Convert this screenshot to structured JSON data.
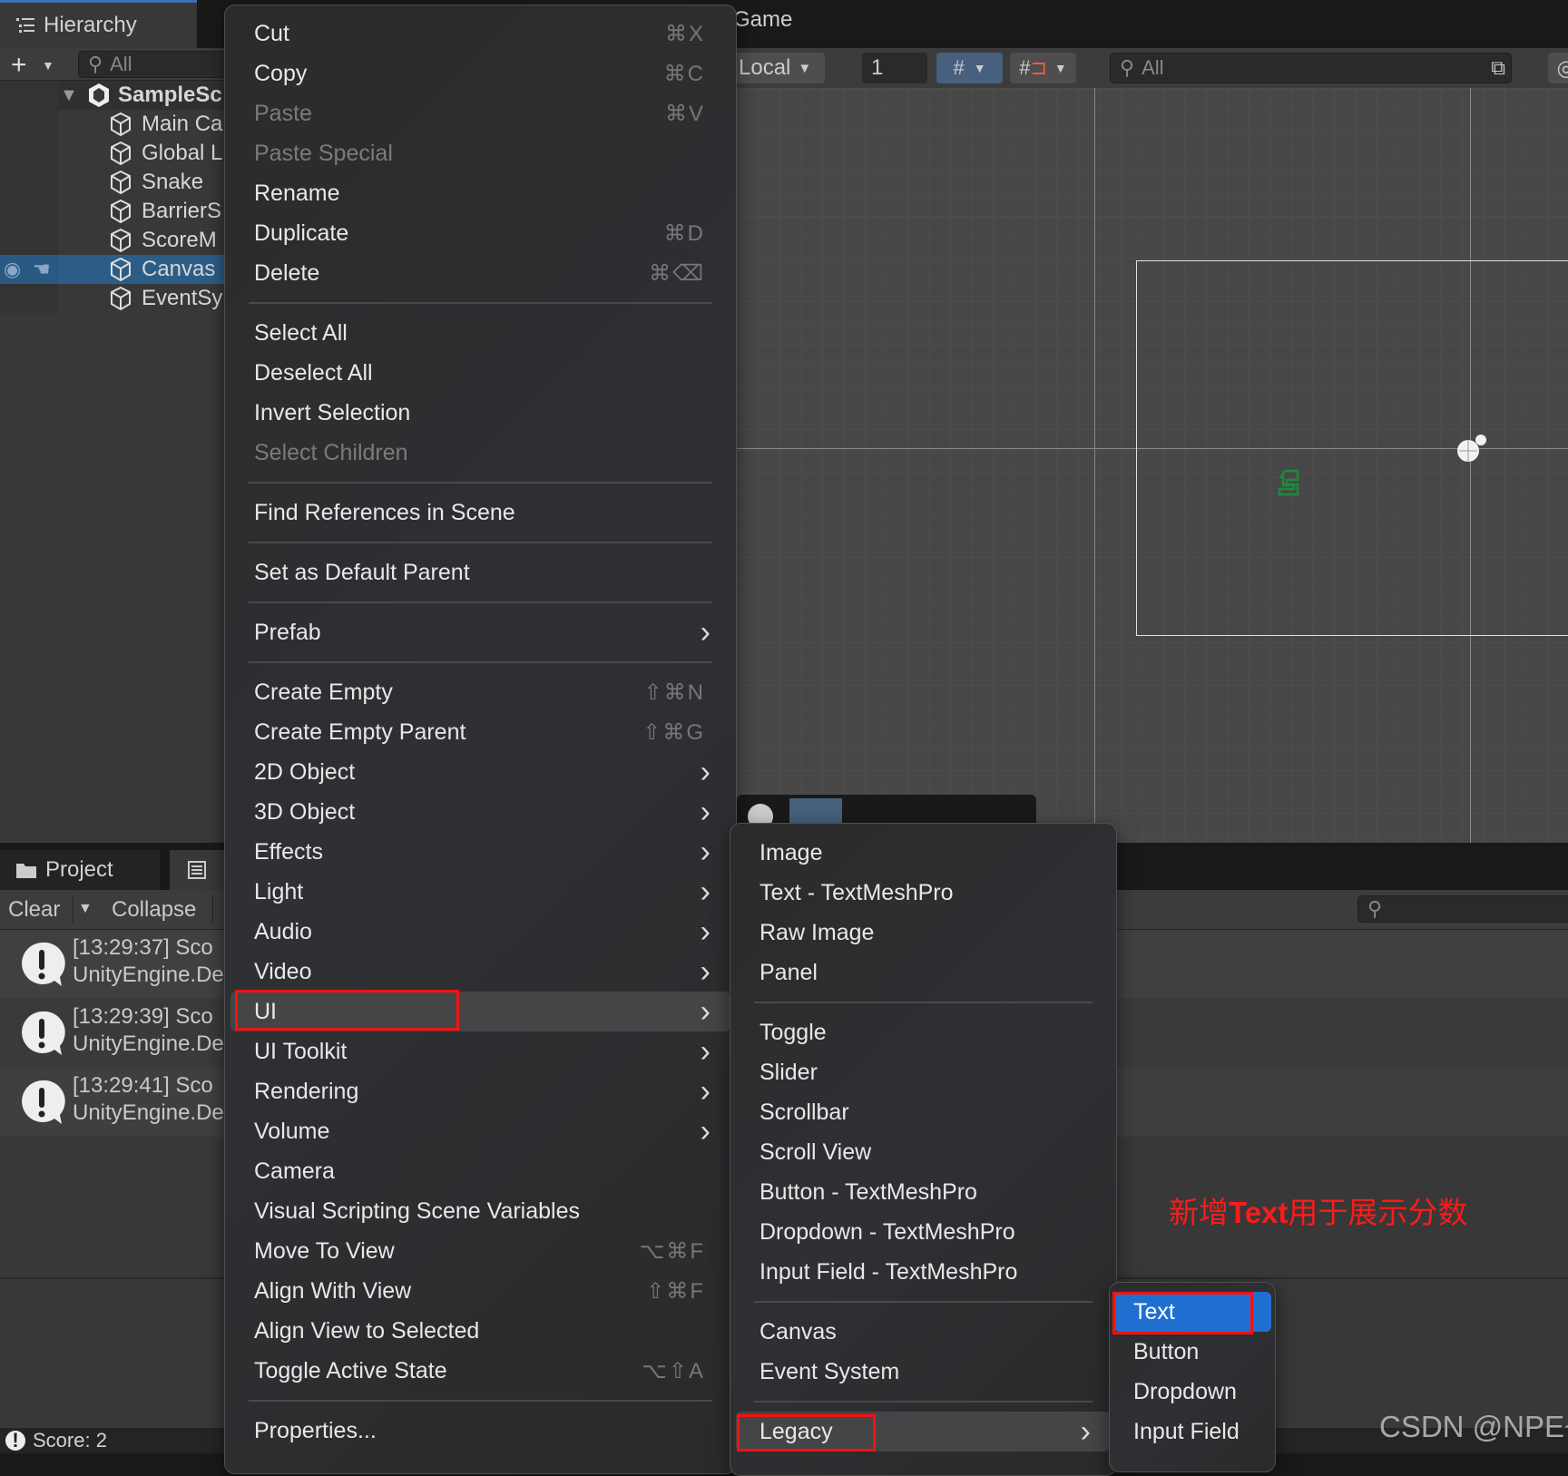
{
  "hierarchy": {
    "tab_label": "Hierarchy",
    "search_placeholder": "All",
    "items": [
      {
        "label": "SampleSc",
        "type": "scene"
      },
      {
        "label": "Main Ca"
      },
      {
        "label": "Global L"
      },
      {
        "label": "Snake"
      },
      {
        "label": "BarrierS"
      },
      {
        "label": "ScoreM"
      },
      {
        "label": "Canvas",
        "selected": true
      },
      {
        "label": "EventSy"
      }
    ]
  },
  "game": {
    "tab_label": "Game",
    "pivot_label": "Local",
    "grid_size_value": "1",
    "search_placeholder": "All"
  },
  "console": {
    "project_tab": "Project",
    "clear_label": "Clear",
    "collapse_label": "Collapse",
    "entries": [
      {
        "line1": "[13:29:37] Sco",
        "line2": "UnityEngine.De"
      },
      {
        "line1": "[13:29:39] Sco",
        "line2": "UnityEngine.De"
      },
      {
        "line1": "[13:29:41] Sco",
        "line2": "UnityEngine.De"
      }
    ],
    "status": "Score: 2"
  },
  "context_menu": {
    "items": [
      {
        "label": "Cut",
        "shortcut": "⌘X"
      },
      {
        "label": "Copy",
        "shortcut": "⌘C"
      },
      {
        "label": "Paste",
        "shortcut": "⌘V",
        "disabled": true
      },
      {
        "label": "Paste Special",
        "disabled": true
      },
      {
        "label": "Rename"
      },
      {
        "label": "Duplicate",
        "shortcut": "⌘D"
      },
      {
        "label": "Delete",
        "shortcut": "⌘⌫"
      },
      {
        "sep": true
      },
      {
        "label": "Select All"
      },
      {
        "label": "Deselect All"
      },
      {
        "label": "Invert Selection"
      },
      {
        "label": "Select Children",
        "disabled": true
      },
      {
        "sep": true
      },
      {
        "label": "Find References in Scene"
      },
      {
        "sep": true
      },
      {
        "label": "Set as Default Parent"
      },
      {
        "sep": true
      },
      {
        "label": "Prefab",
        "submenu": true
      },
      {
        "sep": true
      },
      {
        "label": "Create Empty",
        "shortcut": "⇧⌘N"
      },
      {
        "label": "Create Empty Parent",
        "shortcut": "⇧⌘G"
      },
      {
        "label": "2D Object",
        "submenu": true
      },
      {
        "label": "3D Object",
        "submenu": true
      },
      {
        "label": "Effects",
        "submenu": true
      },
      {
        "label": "Light",
        "submenu": true
      },
      {
        "label": "Audio",
        "submenu": true
      },
      {
        "label": "Video",
        "submenu": true
      },
      {
        "label": "UI",
        "submenu": true,
        "highlighted": true
      },
      {
        "label": "UI Toolkit",
        "submenu": true
      },
      {
        "label": "Rendering",
        "submenu": true
      },
      {
        "label": "Volume",
        "submenu": true
      },
      {
        "label": "Camera"
      },
      {
        "label": "Visual Scripting Scene Variables"
      },
      {
        "label": "Move To View",
        "shortcut": "⌥⌘F"
      },
      {
        "label": "Align With View",
        "shortcut": "⇧⌘F"
      },
      {
        "label": "Align View to Selected"
      },
      {
        "label": "Toggle Active State",
        "shortcut": "⌥⇧A"
      },
      {
        "sep": true
      },
      {
        "label": "Properties..."
      }
    ]
  },
  "ui_submenu": {
    "items": [
      {
        "label": "Image"
      },
      {
        "label": "Text - TextMeshPro"
      },
      {
        "label": "Raw Image"
      },
      {
        "label": "Panel"
      },
      {
        "sep": true
      },
      {
        "label": "Toggle"
      },
      {
        "label": "Slider"
      },
      {
        "label": "Scrollbar"
      },
      {
        "label": "Scroll View"
      },
      {
        "label": "Button - TextMeshPro"
      },
      {
        "label": "Dropdown - TextMeshPro"
      },
      {
        "label": "Input Field - TextMeshPro"
      },
      {
        "sep": true
      },
      {
        "label": "Canvas"
      },
      {
        "label": "Event System"
      },
      {
        "sep": true
      },
      {
        "label": "Legacy",
        "submenu": true,
        "highlighted": true
      }
    ]
  },
  "legacy_submenu": {
    "items": [
      {
        "label": "Text",
        "selected": true
      },
      {
        "label": "Button"
      },
      {
        "label": "Dropdown"
      },
      {
        "label": "Input Field"
      }
    ]
  },
  "annotation": {
    "prefix": "新增",
    "bold": "Text",
    "suffix": "用于展示分数",
    "color": "#ff1a1a"
  },
  "watermark": "CSDN @NPE~",
  "colors": {
    "selection": "#2c5d87",
    "menu_selected": "#1f6fd0",
    "highlight_box": "#ff1010",
    "snake_gizmo": "#1e8a3a"
  }
}
